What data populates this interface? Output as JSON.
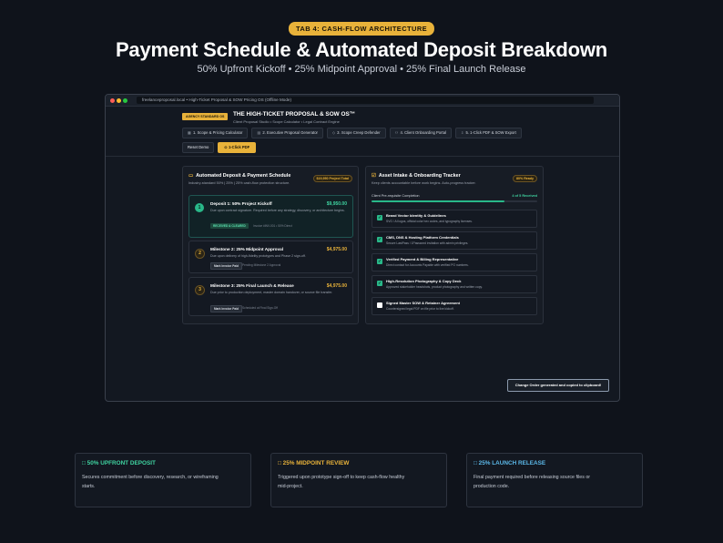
{
  "hero": {
    "tab_pill": "TAB 4: CASH-FLOW ARCHITECTURE",
    "title": "Payment Schedule & Automated Deposit Breakdown",
    "subtitle": "50% Upfront Kickoff • 25% Midpoint Approval • 25% Final Launch Release"
  },
  "browser": {
    "url": "freelanceproposal.local • High-Ticket Proposal & SOW Pricing OS (Offline Mode)"
  },
  "app": {
    "badge": "AGENCY STANDARD OS",
    "title": "THE HIGH-TICKET PROPOSAL & SOW OS™",
    "subtitle": "Client Proposal Studio • Scope Calculator • Legal Contract Engine",
    "tabs": [
      {
        "icon": "▦",
        "label": "1. Scope & Pricing Calculator"
      },
      {
        "icon": "▤",
        "label": "2. Executive Proposal Generator"
      },
      {
        "icon": "◇",
        "label": "3. Scope Creep Defender"
      },
      {
        "icon": "⚇",
        "label": "4. Client Onboarding Portal"
      },
      {
        "icon": "⇩",
        "label": "5. 1-Click PDF & SOW Export"
      }
    ],
    "reset_label": "Reset Demo",
    "pdf_label": "⊙ 1-Click PDF"
  },
  "schedule": {
    "title": "Automated Deposit & Payment Schedule",
    "subtitle": "Industry-standard 50% | 25% | 25% cash-flow protection structure.",
    "total": "$19,950 Project Total",
    "milestones": [
      {
        "num": "1",
        "title": "Deposit 1: 50% Project Kickoff",
        "amount": "$9,950.00",
        "desc": "Due upon contract signature. Required before any strategy, discovery, or architecture begins.",
        "badge": "RECEIVED & CLEARED",
        "note": "Invoice #INV-001 • 50% Direct"
      },
      {
        "num": "2",
        "title": "Milestone 2: 25% Midpoint Approval",
        "amount": "$4,975.00",
        "desc": "Due upon delivery of high-fidelity prototypes and Phase 2 sign-off.",
        "badge": "Mark Invoice Paid",
        "note": "Pending Milestone 2 Approval"
      },
      {
        "num": "3",
        "title": "Milestone 3: 25% Final Launch & Release",
        "amount": "$4,975.00",
        "desc": "Due prior to production deployment, master domain handover, or source file transfer.",
        "badge": "Mark Invoice Paid",
        "note": "Scheduled at Final Sign-Off"
      }
    ]
  },
  "tracker": {
    "title": "Asset Intake & Onboarding Tracker",
    "subtitle": "Keep clients accountable before work begins. Auto-progress tracker.",
    "ready": "80% Ready",
    "progress_label": "Client Pre-requisite Completion",
    "progress_count": "4 of 5 Received",
    "progress_fraction": 0.8,
    "assets": [
      {
        "checked": true,
        "title": "Brand Vector Identity & Guidelines",
        "desc": "SVG / AI logos, official color hex codes, and typography licenses."
      },
      {
        "checked": true,
        "title": "CMS, DNS & Hosting Platform Credentials",
        "desc": "Secure LastPass / 1Password invitation with admin privileges."
      },
      {
        "checked": true,
        "title": "Verified Payment & Billing Representative",
        "desc": "Direct contact for Accounts Payable with verified PO numbers."
      },
      {
        "checked": true,
        "title": "High-Resolution Photography & Copy Deck",
        "desc": "Approved stakeholder headshots, product photography and written copy."
      },
      {
        "checked": false,
        "title": "Signed Master SOW & Retainer Agreement",
        "desc": "Countersigned legal PDF on file prior to live kickoff."
      }
    ]
  },
  "toast": "Change Order generated and copied to clipboard!",
  "cards": [
    {
      "title": "□ 50% UPFRONT DEPOSIT",
      "body": "Secures commitment before discovery, research, or wireframing starts.",
      "color": "#3fd3a0"
    },
    {
      "title": "□ 25% MIDPOINT REVIEW",
      "body": "Triggered upon prototype sign-off to keep cash-flow healthy mid-project.",
      "color": "#e8b23a"
    },
    {
      "title": "□ 25% LAUNCH RELEASE",
      "body": "Final payment required before releasing source files or production code.",
      "color": "#5bb8e8"
    }
  ]
}
